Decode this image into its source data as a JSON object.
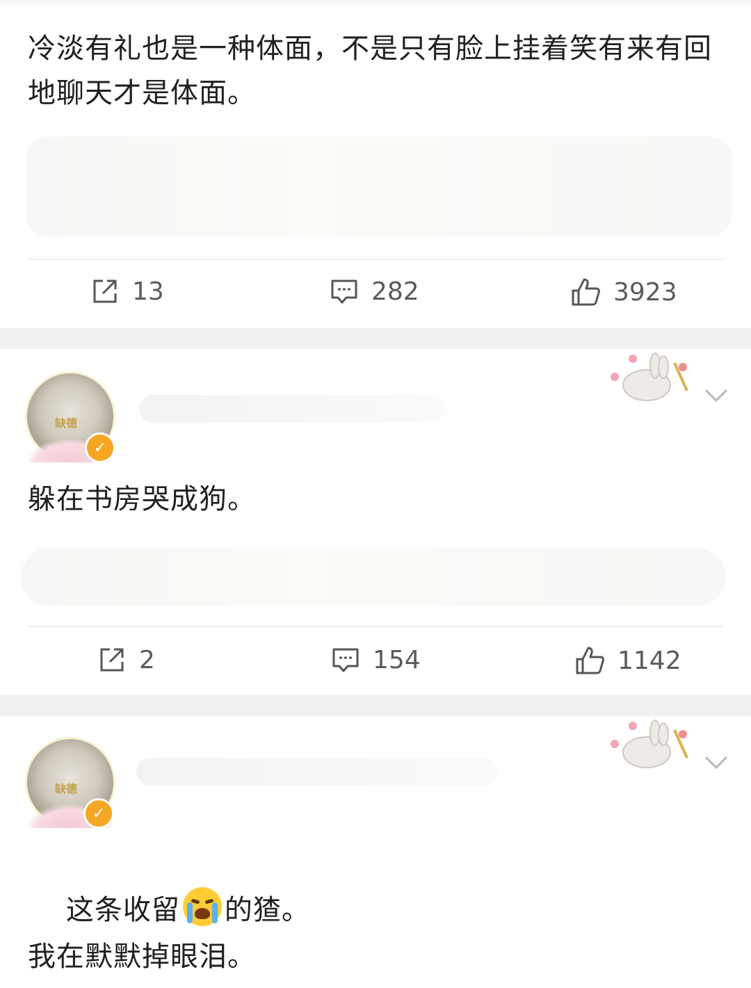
{
  "posts": [
    {
      "text": "冷淡有礼也是一种体面，不是只有脸上挂着笑有来有回地聊天才是体面。",
      "actions": {
        "repost": "13",
        "comment": "282",
        "like": "3923"
      }
    },
    {
      "avatar_tag": "缺德",
      "text": "躲在书房哭成狗。",
      "actions": {
        "repost": "2",
        "comment": "154",
        "like": "1142"
      }
    },
    {
      "avatar_tag": "缺德",
      "text_line1_before": "这条收留",
      "text_line1_after": "的猹。",
      "text_line2": "我在默默掉眼泪。"
    }
  ],
  "icons": {
    "repost": "repost-icon",
    "comment": "comment-icon",
    "like": "thumbs-up-icon",
    "more": "chevron-down-icon",
    "emoji": "crying-face-icon",
    "verified": "verified-badge-icon"
  },
  "colors": {
    "separator": "#f1f1f2",
    "badge": "#f5a623",
    "text": "#202020",
    "meta": "#5a5a5a"
  }
}
